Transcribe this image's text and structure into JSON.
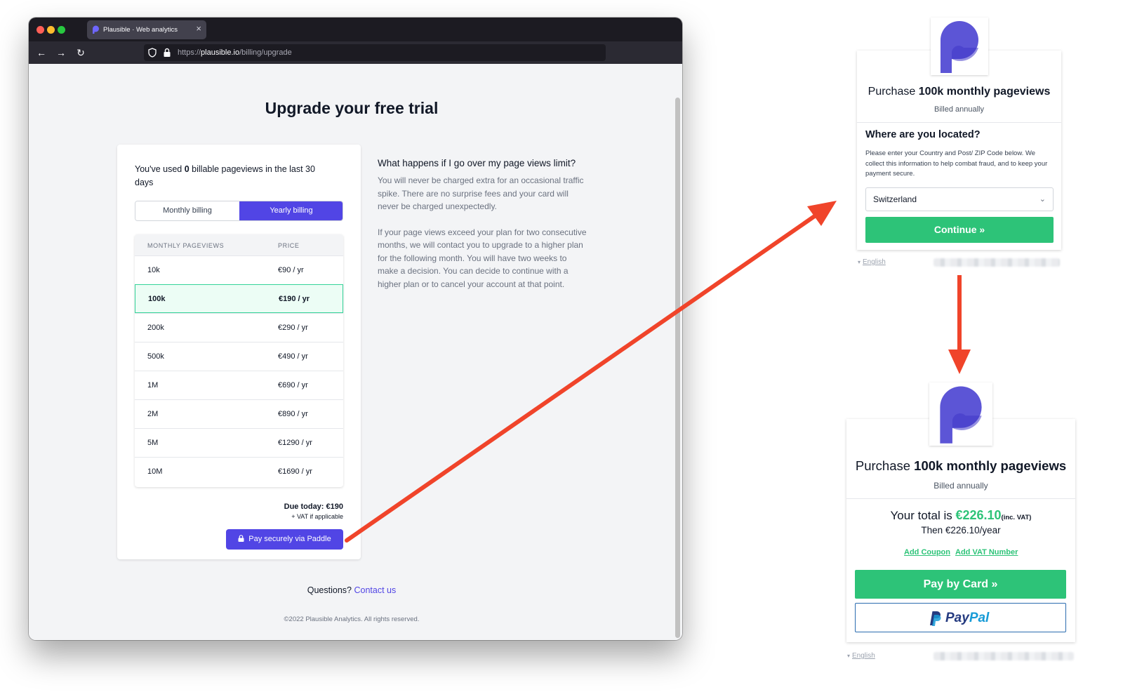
{
  "browser": {
    "tab_title": "Plausible · Web analytics",
    "tab_close": "×",
    "url_prefix": "https://",
    "url_host": "plausible.io",
    "url_path": "/billing/upgrade",
    "icons": [
      "back-icon",
      "forward-icon",
      "reload-icon",
      "shield-icon",
      "lock-icon",
      "plausible-favicon-icon"
    ]
  },
  "page": {
    "title": "Upgrade your free trial",
    "usage": {
      "before": "You've used ",
      "count": "0",
      "after": " billable pageviews in the last 30 days"
    },
    "billing_toggle": {
      "monthly_label": "Monthly billing",
      "yearly_label": "Yearly billing",
      "selected": "yearly"
    },
    "plans": {
      "header_pageviews": "MONTHLY PAGEVIEWS",
      "header_price": "PRICE",
      "rows": [
        {
          "pageviews": "10k",
          "price": "€90 / yr"
        },
        {
          "pageviews": "100k",
          "price": "€190 / yr",
          "selected": true
        },
        {
          "pageviews": "200k",
          "price": "€290 / yr"
        },
        {
          "pageviews": "500k",
          "price": "€490 / yr"
        },
        {
          "pageviews": "1M",
          "price": "€690 / yr"
        },
        {
          "pageviews": "2M",
          "price": "€890 / yr"
        },
        {
          "pageviews": "5M",
          "price": "€1290 / yr"
        },
        {
          "pageviews": "10M",
          "price": "€1690 / yr"
        }
      ]
    },
    "due_today": "Due today: €190",
    "vat_note": "+ VAT if applicable",
    "pay_button": "Pay securely via Paddle",
    "faq": {
      "question": "What happens if I go over my page views limit?",
      "answer_1": "You will never be charged extra for an occasional traffic spike. There are no surprise fees and your card will never be charged unexpectedly.",
      "answer_2": "If your page views exceed your plan for two consecutive months, we will contact you to upgrade to a higher plan for the following month. You will have two weeks to make a decision. You can decide to continue with a higher plan or to cancel your account at that point."
    },
    "questions_text": "Questions? ",
    "contact_link": "Contact us",
    "copyright": "©2022 Plausible Analytics. All rights reserved."
  },
  "checkout_location": {
    "title_prefix": "Purchase ",
    "title_bold": "100k monthly pageviews",
    "billed": "Billed annually",
    "heading": "Where are you located?",
    "description": "Please enter your Country and Post/ ZIP Code below. We collect this information to help combat fraud, and to keep your payment secure.",
    "country_value": "Switzerland",
    "continue_label": "Continue »",
    "language": "English"
  },
  "checkout_payment": {
    "title_prefix": "Purchase ",
    "title_bold": "100k monthly pageviews",
    "billed": "Billed annually",
    "total_prefix": "Your total is ",
    "total_amount": "€226.10",
    "total_suffix": "(inc. VAT)",
    "then_text": "Then €226.10/year",
    "add_coupon": "Add Coupon",
    "add_vat": "Add VAT Number",
    "pay_card_label": "Pay by Card »",
    "paypal_pay": "Pay",
    "paypal_pal": "Pal",
    "language": "English"
  },
  "colors": {
    "brand_indigo": "#5145e5",
    "paddle_green": "#2dc378",
    "arrow_red": "#f0442a",
    "paypal_dark": "#253b80",
    "paypal_light": "#179bd7"
  }
}
